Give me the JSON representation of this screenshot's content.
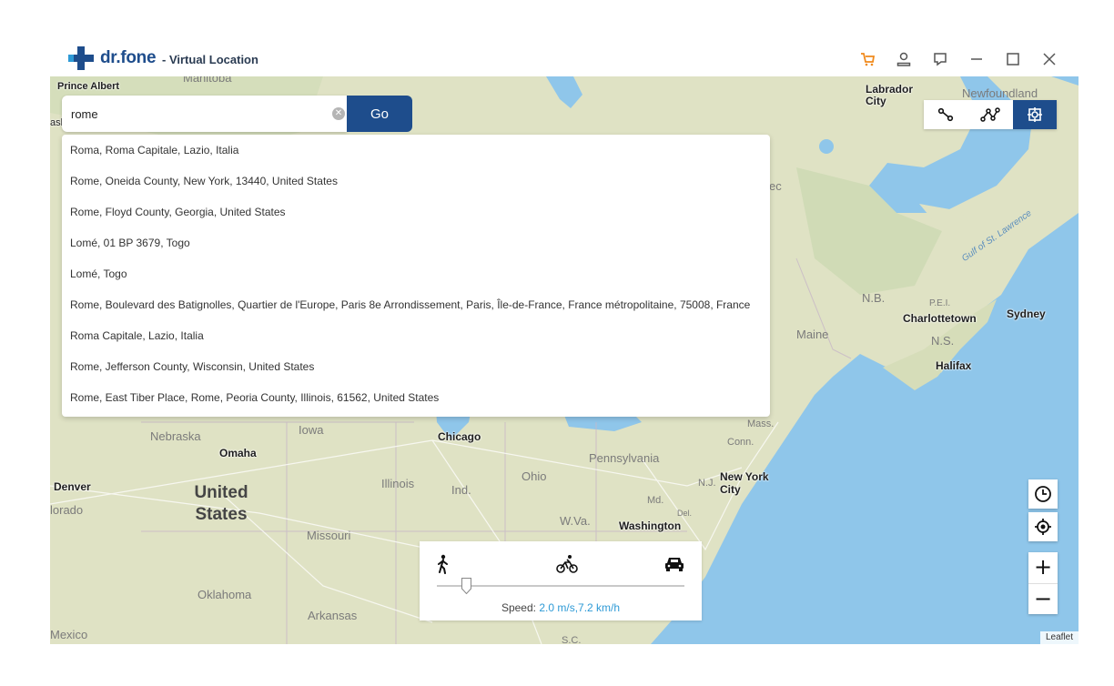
{
  "app": {
    "brand": "dr.fone",
    "subtitle": "- Virtual Location",
    "brand_color": "#1e4d8c",
    "window_icons": [
      "cart-icon",
      "user-icon",
      "feedback-icon",
      "minimize-icon",
      "maximize-icon",
      "close-icon"
    ]
  },
  "search": {
    "value": "rome",
    "go_label": "Go",
    "results": [
      "Roma, Roma Capitale, Lazio, Italia",
      "Rome, Oneida County, New York, 13440, United States",
      "Rome, Floyd County, Georgia, United States",
      "Lomé, 01 BP 3679, Togo",
      "Lomé, Togo",
      "Rome, Boulevard des Batignolles, Quartier de l'Europe, Paris 8e Arrondissement, Paris, Île-de-France, France métropolitaine, 75008, France",
      "Roma Capitale, Lazio, Italia",
      "Rome, Jefferson County, Wisconsin, United States",
      "Rome, East Tiber Place, Rome, Peoria County, Illinois, 61562, United States"
    ]
  },
  "modes": {
    "items": [
      "one-stop-route-icon",
      "multi-stop-route-icon",
      "teleport-icon"
    ],
    "active": "teleport-icon"
  },
  "map": {
    "labels": {
      "prince_albert": "Prince Albert",
      "manitoba": "Manitoba",
      "labrador_city": "Labrador City",
      "newfoundland": "Newfoundland",
      "quebec_frag": "ec",
      "gulf": "Gulf of St. Lawrence",
      "nb": "N.B.",
      "pei": "P.E.I.",
      "charlottetown": "Charlottetown",
      "sydney": "Sydney",
      "maine": "Maine",
      "ns": "N.S.",
      "halifax": "Halifax",
      "nebraska": "Nebraska",
      "iowa": "Iowa",
      "omaha": "Omaha",
      "chicago": "Chicago",
      "mass": "Mass.",
      "conn": "Conn.",
      "pennsylvania": "Pennsylvania",
      "denver": "Denver",
      "colorado_frag": "lorado",
      "united_states": "United States",
      "illinois": "Illinois",
      "ind": "Ind.",
      "ohio": "Ohio",
      "new_york_city": "New York City",
      "nj": "N.J.",
      "md": "Md.",
      "del": "Del.",
      "wva": "W.Va.",
      "washington": "Washington",
      "missouri": "Missouri",
      "oklahoma": "Oklahoma",
      "arkansas": "Arkansas",
      "mexico": "Mexico",
      "sc": "S.C.",
      "sask_frag": "asl"
    },
    "controls": [
      "history-icon",
      "locate-icon"
    ],
    "zoom_in": "+",
    "zoom_out": "−",
    "attribution": "Leaflet",
    "land_color": "#dfe2c4",
    "water_color": "#8fc6ea"
  },
  "speed": {
    "modes": [
      "walk-icon",
      "bike-icon",
      "car-icon"
    ],
    "label": "Speed:",
    "value": "2.0 m/s,7.2 km/h",
    "slider_fraction": 0.12,
    "value_color": "#2e9ad6"
  }
}
